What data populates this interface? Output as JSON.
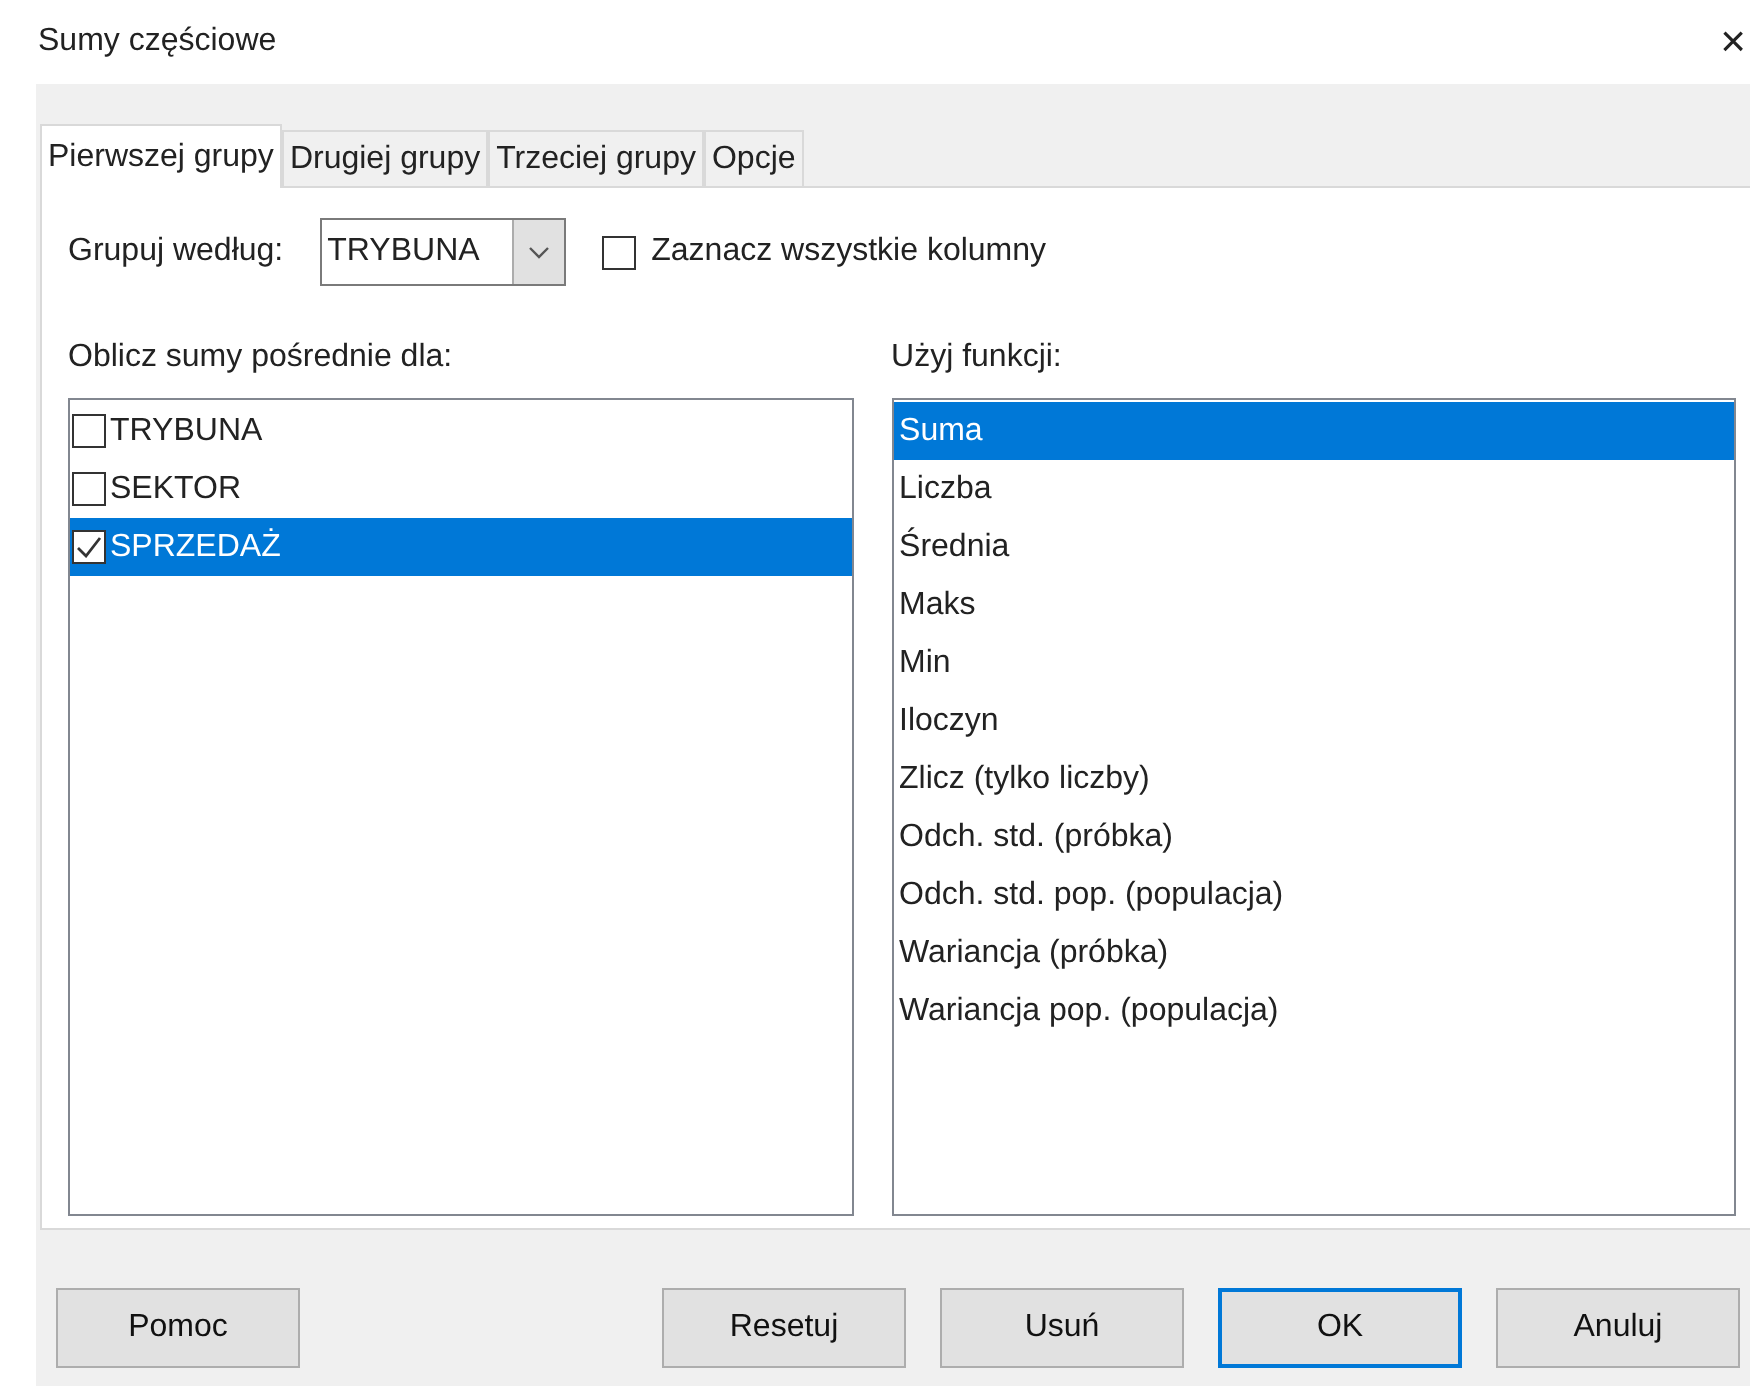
{
  "window": {
    "title": "Sumy częściowe",
    "close": "×"
  },
  "tabs": [
    {
      "label": "Pierwszej grupy",
      "selected": true
    },
    {
      "label": "Drugiej grupy",
      "selected": false
    },
    {
      "label": "Trzeciej grupy",
      "selected": false
    },
    {
      "label": "Opcje",
      "selected": false
    }
  ],
  "group_by": {
    "label": "Grupuj według:",
    "value": "TRYBUNA"
  },
  "select_all": {
    "label": "Zaznacz wszystkie kolumny",
    "checked": false
  },
  "columns": {
    "label": "Oblicz sumy pośrednie dla:",
    "items": [
      {
        "label": "TRYBUNA",
        "checked": false,
        "selected": false
      },
      {
        "label": "SEKTOR",
        "checked": false,
        "selected": false
      },
      {
        "label": "SPRZEDAŻ",
        "checked": true,
        "selected": true
      }
    ]
  },
  "functions": {
    "label": "Użyj funkcji:",
    "items": [
      {
        "label": "Suma",
        "selected": true
      },
      {
        "label": "Liczba",
        "selected": false
      },
      {
        "label": "Średnia",
        "selected": false
      },
      {
        "label": "Maks",
        "selected": false
      },
      {
        "label": "Min",
        "selected": false
      },
      {
        "label": "Iloczyn",
        "selected": false
      },
      {
        "label": "Zlicz (tylko liczby)",
        "selected": false
      },
      {
        "label": "Odch. std. (próbka)",
        "selected": false
      },
      {
        "label": "Odch. std. pop. (populacja)",
        "selected": false
      },
      {
        "label": "Wariancja (próbka)",
        "selected": false
      },
      {
        "label": "Wariancja pop. (populacja)",
        "selected": false
      }
    ]
  },
  "buttons": [
    {
      "label": "Pomoc",
      "default": false
    },
    {
      "label": "Resetuj",
      "default": false
    },
    {
      "label": "Usuń",
      "default": false
    },
    {
      "label": "OK",
      "default": true
    },
    {
      "label": "Anuluj",
      "default": false
    }
  ]
}
